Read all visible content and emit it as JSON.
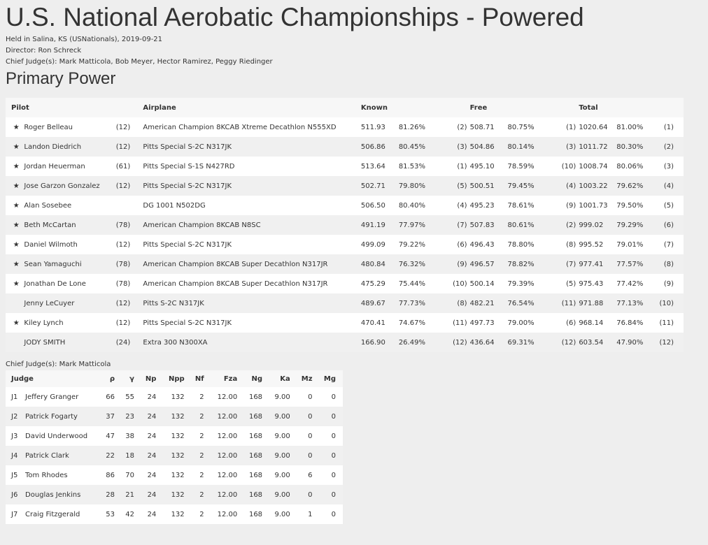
{
  "page": {
    "title": "U.S. National Aerobatic Championships - Powered",
    "held": "Held in Salina, KS (USNationals), 2019-09-21",
    "director": "Director: Ron Schreck",
    "chief_judges": "Chief Judge(s): Mark Matticola, Bob Meyer, Hector Ramirez, Peggy Riedinger"
  },
  "category": {
    "title": "Primary Power",
    "headers": {
      "pilot": "Pilot",
      "airplane": "Airplane",
      "known": "Known",
      "free": "Free",
      "total": "Total"
    },
    "star_icon": "★",
    "rows": [
      {
        "star": "★",
        "pilot": "Roger Belleau",
        "num": "(12)",
        "airplane": "American Champion 8KCAB Xtreme Decathlon N555XD",
        "known": "511.93",
        "known_pct": "81.26%",
        "known_rank": "(2)",
        "free": "508.71",
        "free_pct": "80.75%",
        "free_rank": "(1)",
        "total": "1020.64",
        "total_pct": "81.00%",
        "total_rank": "(1)"
      },
      {
        "star": "★",
        "pilot": "Landon Diedrich",
        "num": "(12)",
        "airplane": "Pitts Special S-2C N317JK",
        "known": "506.86",
        "known_pct": "80.45%",
        "known_rank": "(3)",
        "free": "504.86",
        "free_pct": "80.14%",
        "free_rank": "(3)",
        "total": "1011.72",
        "total_pct": "80.30%",
        "total_rank": "(2)"
      },
      {
        "star": "★",
        "pilot": "Jordan Heuerman",
        "num": "(61)",
        "airplane": "Pitts Special S-1S N427RD",
        "known": "513.64",
        "known_pct": "81.53%",
        "known_rank": "(1)",
        "free": "495.10",
        "free_pct": "78.59%",
        "free_rank": "(10)",
        "total": "1008.74",
        "total_pct": "80.06%",
        "total_rank": "(3)"
      },
      {
        "star": "★",
        "pilot": "Jose Garzon Gonzalez",
        "num": "(12)",
        "airplane": "Pitts Special S-2C N317JK",
        "known": "502.71",
        "known_pct": "79.80%",
        "known_rank": "(5)",
        "free": "500.51",
        "free_pct": "79.45%",
        "free_rank": "(4)",
        "total": "1003.22",
        "total_pct": "79.62%",
        "total_rank": "(4)"
      },
      {
        "star": "★",
        "pilot": "Alan Sosebee",
        "num": "",
        "airplane": "DG 1001 N502DG",
        "known": "506.50",
        "known_pct": "80.40%",
        "known_rank": "(4)",
        "free": "495.23",
        "free_pct": "78.61%",
        "free_rank": "(9)",
        "total": "1001.73",
        "total_pct": "79.50%",
        "total_rank": "(5)"
      },
      {
        "star": "★",
        "pilot": "Beth McCartan",
        "num": "(78)",
        "airplane": "American Champion 8KCAB N8SC",
        "known": "491.19",
        "known_pct": "77.97%",
        "known_rank": "(7)",
        "free": "507.83",
        "free_pct": "80.61%",
        "free_rank": "(2)",
        "total": "999.02",
        "total_pct": "79.29%",
        "total_rank": "(6)"
      },
      {
        "star": "★",
        "pilot": "Daniel Wilmoth",
        "num": "(12)",
        "airplane": "Pitts Special S-2C N317JK",
        "known": "499.09",
        "known_pct": "79.22%",
        "known_rank": "(6)",
        "free": "496.43",
        "free_pct": "78.80%",
        "free_rank": "(8)",
        "total": "995.52",
        "total_pct": "79.01%",
        "total_rank": "(7)"
      },
      {
        "star": "★",
        "pilot": "Sean Yamaguchi",
        "num": "(78)",
        "airplane": "American Champion 8KCAB Super Decathlon N317JR",
        "known": "480.84",
        "known_pct": "76.32%",
        "known_rank": "(9)",
        "free": "496.57",
        "free_pct": "78.82%",
        "free_rank": "(7)",
        "total": "977.41",
        "total_pct": "77.57%",
        "total_rank": "(8)"
      },
      {
        "star": "★",
        "pilot": "Jonathan De Lone",
        "num": "(78)",
        "airplane": "American Champion 8KCAB Super Decathlon N317JR",
        "known": "475.29",
        "known_pct": "75.44%",
        "known_rank": "(10)",
        "free": "500.14",
        "free_pct": "79.39%",
        "free_rank": "(5)",
        "total": "975.43",
        "total_pct": "77.42%",
        "total_rank": "(9)"
      },
      {
        "star": "",
        "pilot": "Jenny LeCuyer",
        "num": "(12)",
        "airplane": "Pitts S-2C N317JK",
        "known": "489.67",
        "known_pct": "77.73%",
        "known_rank": "(8)",
        "free": "482.21",
        "free_pct": "76.54%",
        "free_rank": "(11)",
        "total": "971.88",
        "total_pct": "77.13%",
        "total_rank": "(10)"
      },
      {
        "star": "★",
        "pilot": "Kiley Lynch",
        "num": "(12)",
        "airplane": "Pitts Special S-2C N317JK",
        "known": "470.41",
        "known_pct": "74.67%",
        "known_rank": "(11)",
        "free": "497.73",
        "free_pct": "79.00%",
        "free_rank": "(6)",
        "total": "968.14",
        "total_pct": "76.84%",
        "total_rank": "(11)"
      },
      {
        "star": "",
        "pilot": "JODY SMITH",
        "num": "(24)",
        "airplane": "Extra 300 N300XA",
        "known": "166.90",
        "known_pct": "26.49%",
        "known_rank": "(12)",
        "free": "436.64",
        "free_pct": "69.31%",
        "free_rank": "(12)",
        "total": "603.54",
        "total_pct": "47.90%",
        "total_rank": "(12)"
      }
    ]
  },
  "judges": {
    "chief": "Chief Judge(s): Mark Matticola",
    "headers": [
      "Judge",
      "ρ",
      "γ",
      "Np",
      "Npp",
      "Nf",
      "Fza",
      "Ng",
      "Ka",
      "Mz",
      "Mg"
    ],
    "rows": [
      {
        "id": "J1",
        "name": "Jeffery Granger",
        "rho": "66",
        "gamma": "55",
        "np": "24",
        "npp": "132",
        "nf": "2",
        "fza": "12.00",
        "ng": "168",
        "ka": "9.00",
        "mz": "0",
        "mg": "0"
      },
      {
        "id": "J2",
        "name": "Patrick Fogarty",
        "rho": "37",
        "gamma": "23",
        "np": "24",
        "npp": "132",
        "nf": "2",
        "fza": "12.00",
        "ng": "168",
        "ka": "9.00",
        "mz": "0",
        "mg": "0"
      },
      {
        "id": "J3",
        "name": "David Underwood",
        "rho": "47",
        "gamma": "38",
        "np": "24",
        "npp": "132",
        "nf": "2",
        "fza": "12.00",
        "ng": "168",
        "ka": "9.00",
        "mz": "0",
        "mg": "0"
      },
      {
        "id": "J4",
        "name": "Patrick Clark",
        "rho": "22",
        "gamma": "18",
        "np": "24",
        "npp": "132",
        "nf": "2",
        "fza": "12.00",
        "ng": "168",
        "ka": "9.00",
        "mz": "0",
        "mg": "0"
      },
      {
        "id": "J5",
        "name": "Tom Rhodes",
        "rho": "86",
        "gamma": "70",
        "np": "24",
        "npp": "132",
        "nf": "2",
        "fza": "12.00",
        "ng": "168",
        "ka": "9.00",
        "mz": "6",
        "mg": "0"
      },
      {
        "id": "J6",
        "name": "Douglas Jenkins",
        "rho": "28",
        "gamma": "21",
        "np": "24",
        "npp": "132",
        "nf": "2",
        "fza": "12.00",
        "ng": "168",
        "ka": "9.00",
        "mz": "0",
        "mg": "0"
      },
      {
        "id": "J7",
        "name": "Craig Fitzgerald",
        "rho": "53",
        "gamma": "42",
        "np": "24",
        "npp": "132",
        "nf": "2",
        "fza": "12.00",
        "ng": "168",
        "ka": "9.00",
        "mz": "1",
        "mg": "0"
      }
    ]
  }
}
